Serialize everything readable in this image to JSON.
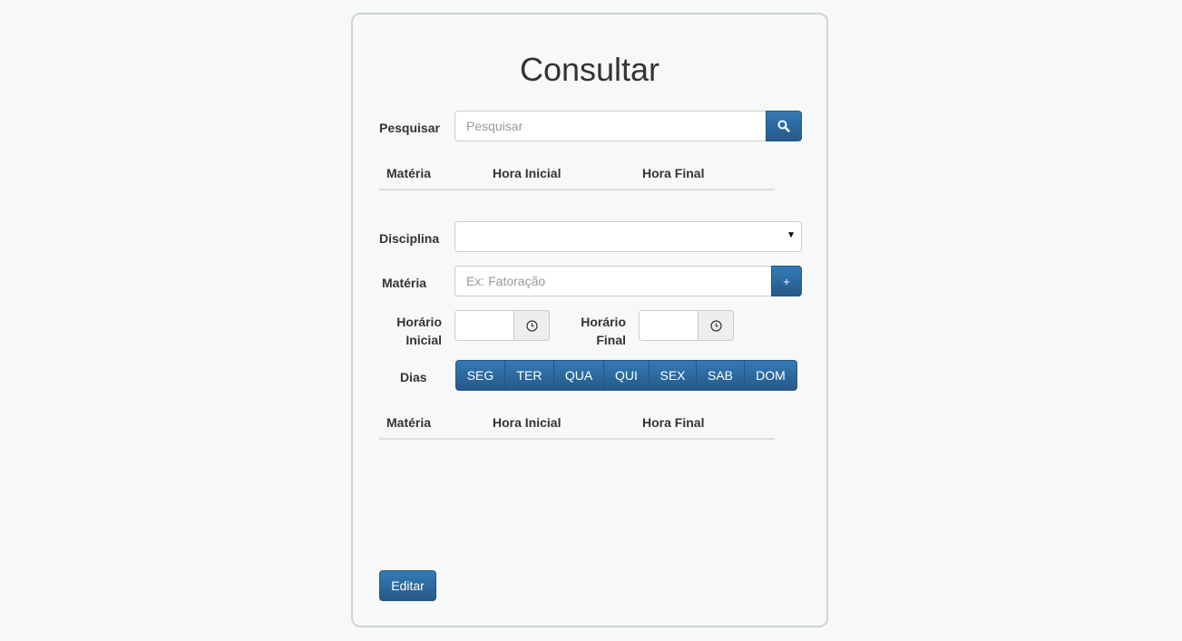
{
  "title": "Consultar",
  "search": {
    "label": "Pesquisar",
    "placeholder": "Pesquisar",
    "button_icon": "search-icon"
  },
  "table1": {
    "headers": [
      "Matéria",
      "Hora Inicial",
      "Hora Final"
    ]
  },
  "disciplina": {
    "label": "Disciplina",
    "selected": ""
  },
  "materia": {
    "label": "Matéria",
    "placeholder": "Ex: Fatoração",
    "add_label": "+"
  },
  "horario_inicial": {
    "label_line1": "Horário",
    "label_line2": "Inicial",
    "icon": "clock-icon"
  },
  "horario_final": {
    "label_line1": "Horário",
    "label_line2": "Final",
    "icon": "clock-icon"
  },
  "dias": {
    "label": "Dias",
    "days": [
      "SEG",
      "TER",
      "QUA",
      "QUI",
      "SEX",
      "SAB",
      "DOM"
    ]
  },
  "table2": {
    "headers": [
      "Matéria",
      "Hora Inicial",
      "Hora Final"
    ]
  },
  "edit_button": "Editar",
  "colors": {
    "primary": "#337ab7",
    "primary_dark": "#265a88",
    "background": "#f7f9f9"
  }
}
